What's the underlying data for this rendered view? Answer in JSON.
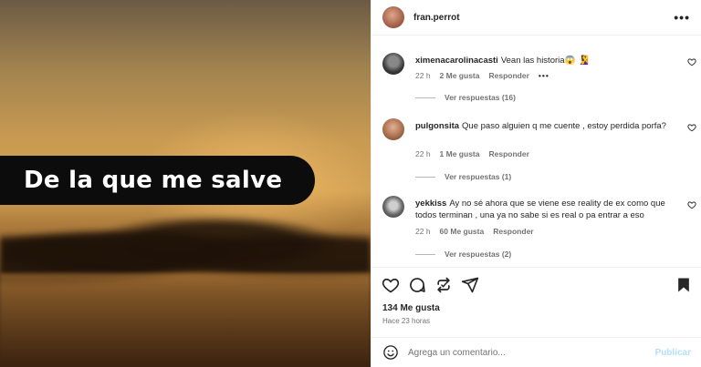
{
  "post": {
    "username": "fran.perrot",
    "media_caption": "De la que me salve",
    "likes_total": "134 Me gusta",
    "time_ago": "Hace 23 horas"
  },
  "comments": [
    {
      "user": "ximenacarolinacasti",
      "text": "Vean las historia😱 🧏‍♀️",
      "time": "22 h",
      "likes": "2 Me gusta",
      "reply_label": "Responder",
      "more": "•••",
      "view_replies": "Ver respuestas (16)"
    },
    {
      "user": "pulgonsita",
      "text": "Que paso alguien q me cuente , estoy perdida porfa?",
      "time": "22 h",
      "likes": "1 Me gusta",
      "reply_label": "Responder",
      "view_replies": "Ver respuestas (1)"
    },
    {
      "user": "yekkiss",
      "text": "Ay no sé ahora que se viene ese reality de ex como que todos terminan , una ya no sabe si es real o pa entrar a eso",
      "time": "22 h",
      "likes": "60 Me gusta",
      "reply_label": "Responder",
      "view_replies": "Ver respuestas (2)"
    }
  ],
  "composer": {
    "placeholder": "Agrega un comentario...",
    "post_label": "Publicar"
  },
  "icons": {
    "header_more": "more-horizontal-icon",
    "like": "heart-icon",
    "comment": "comment-icon",
    "share": "repost-icon",
    "send": "send-icon",
    "save": "bookmark-icon",
    "emoji": "emoji-icon"
  },
  "colors": {
    "accent_disabled": "#b2dffc",
    "muted_text": "#737373"
  }
}
